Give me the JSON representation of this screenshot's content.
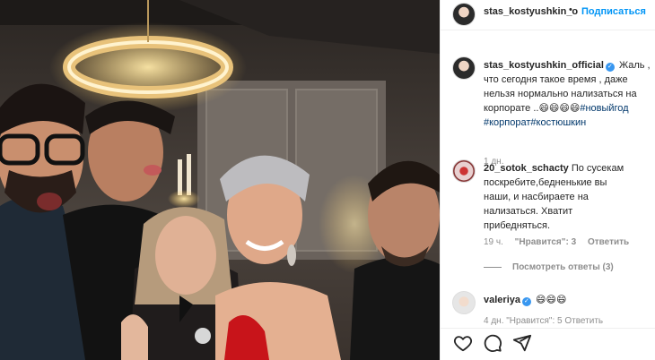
{
  "post_header": {
    "username": "stas_kostyushkin_o",
    "separator": "•",
    "follow_label": "Подписаться"
  },
  "comments": [
    {
      "username": "stas_kostyushkin_official",
      "text_line1": "Жаль ,",
      "text_line2": "что сегодня такое время , даже",
      "text_line3": "нельзя нормально нализаться на",
      "text_line4": "корпорате ..",
      "emojis": "😄😄😄😄",
      "tag1": "#новыйгод",
      "tags_line": "#корпорат#костюшкин",
      "time": "1 дн."
    },
    {
      "username": "20_sotok_schacty",
      "text_line1": "По сусекам",
      "text_line2": "поскребите,бедненькие вы",
      "text_line3": "наши, и насбираете на",
      "text_line4": "нализаться. Хватит",
      "text_line5": "прибедняться.",
      "time": "19 ч.",
      "likes": "\"Нравится\": 3",
      "reply_label": "Ответить",
      "view_replies": "Посмотреть ответы (3)"
    },
    {
      "username": "valeriya",
      "emojis": "😄😄😄",
      "meta_partial": "4 дн.    \"Нравится\": 5    Ответить"
    }
  ],
  "actions": {
    "like_icon": "heart-icon",
    "comment_icon": "comment-icon",
    "share_icon": "share-icon"
  },
  "colors": {
    "link_blue": "#0095f6",
    "hashtag": "#00376b",
    "muted": "#8e8e8e",
    "verified": "#3897f0"
  }
}
